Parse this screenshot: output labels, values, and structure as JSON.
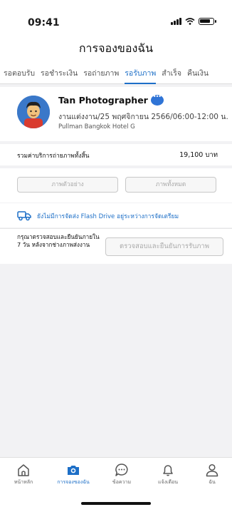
{
  "status_bar": {
    "time": "09:41"
  },
  "header": {
    "title": "การจองของฉัน"
  },
  "tabs": [
    {
      "label": "รอตอบรับ"
    },
    {
      "label": "รอชำระเงิน"
    },
    {
      "label": "รอถ่ายภาพ"
    },
    {
      "label": "รอรับภาพ",
      "active": true
    },
    {
      "label": "สำเร็จ"
    },
    {
      "label": "คืนเงิน"
    }
  ],
  "booking": {
    "photographer_name": "Tan Photographer",
    "detail": "งานแต่งงาน/25 พฤศจิกายน 2566/06:00-12:00 น.",
    "location": "Pullman Bangkok Hotel G",
    "total_label": "รวมค่าบริการถ่ายภาพทั้งสิ้น",
    "total_value": "19,100 บาท",
    "sample_button": "ภาพตัวอย่าง",
    "all_button": "ภาพทั้งหมด",
    "delivery_text": "ยังไม่มีการจัดส่ง Flash Drive อยู่ระหว่างการจัดเตรียม",
    "confirm_text": "กรุณาตรวจสอบและยืนยันภายใน 7 วัน หลังจากช่างภาพส่งงาน",
    "confirm_button": "ตรวจสอบและยืนยันการรับภาพ"
  },
  "bottom_nav": [
    {
      "label": "หน้าหลัก",
      "icon": "home-icon"
    },
    {
      "label": "การจองของฉัน",
      "icon": "camera-icon",
      "active": true
    },
    {
      "label": "ข้อความ",
      "icon": "chat-icon"
    },
    {
      "label": "แจ้งเตือน",
      "icon": "bell-icon"
    },
    {
      "label": "ฉัน",
      "icon": "user-icon"
    }
  ],
  "colors": {
    "accent": "#1d6fc7",
    "background": "#f2f2f4"
  }
}
